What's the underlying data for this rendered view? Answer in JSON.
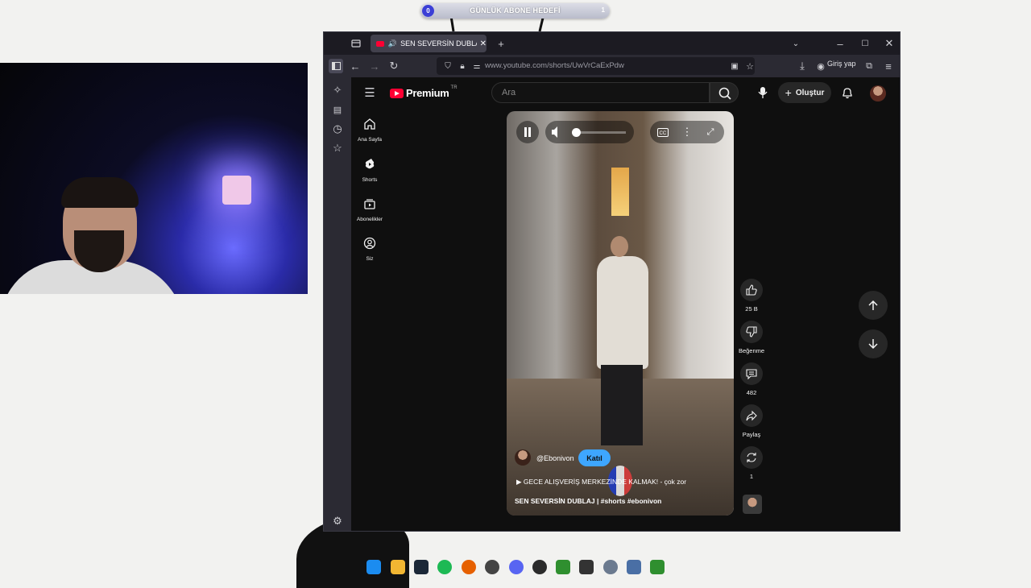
{
  "overlay": {
    "goal_label": "GÜNLÜK ABONE HEDEFİ",
    "goal_current": "0",
    "goal_target": "1"
  },
  "browser": {
    "tab_title": "SEN SEVERSİN DUBLAJ | #s",
    "url": "www.youtube.com/shorts/UwVrCaExPdw",
    "login_label": "Giriş yap"
  },
  "youtube": {
    "logo_text": "Premium",
    "logo_region": "TR",
    "search_placeholder": "Ara",
    "create_label": "Oluştur",
    "nav": [
      {
        "label": "Ana Sayfa",
        "icon": "home-icon"
      },
      {
        "label": "Shorts",
        "icon": "shorts-icon"
      },
      {
        "label": "Abonelikler",
        "icon": "subscriptions-icon"
      },
      {
        "label": "Siz",
        "icon": "you-icon"
      }
    ],
    "short": {
      "channel": "@Ebonivon",
      "join_label": "Katıl",
      "title": "GECE ALIŞVERİŞ MERKEZİNDE KALMAK! - çok zor",
      "description": "SEN SEVERSİN DUBLAJ | #shorts #ebonivon",
      "volume_fraction": 0.0
    },
    "actions": {
      "like_count": "25 B",
      "dislike_label": "Beğenme",
      "comment_count": "482",
      "share_label": "Paylaş",
      "remix_count": "1"
    }
  },
  "colors": {
    "yt_red": "#ff0033",
    "join_blue": "#3ea6ff",
    "goal_blue": "#3b3fd6"
  }
}
